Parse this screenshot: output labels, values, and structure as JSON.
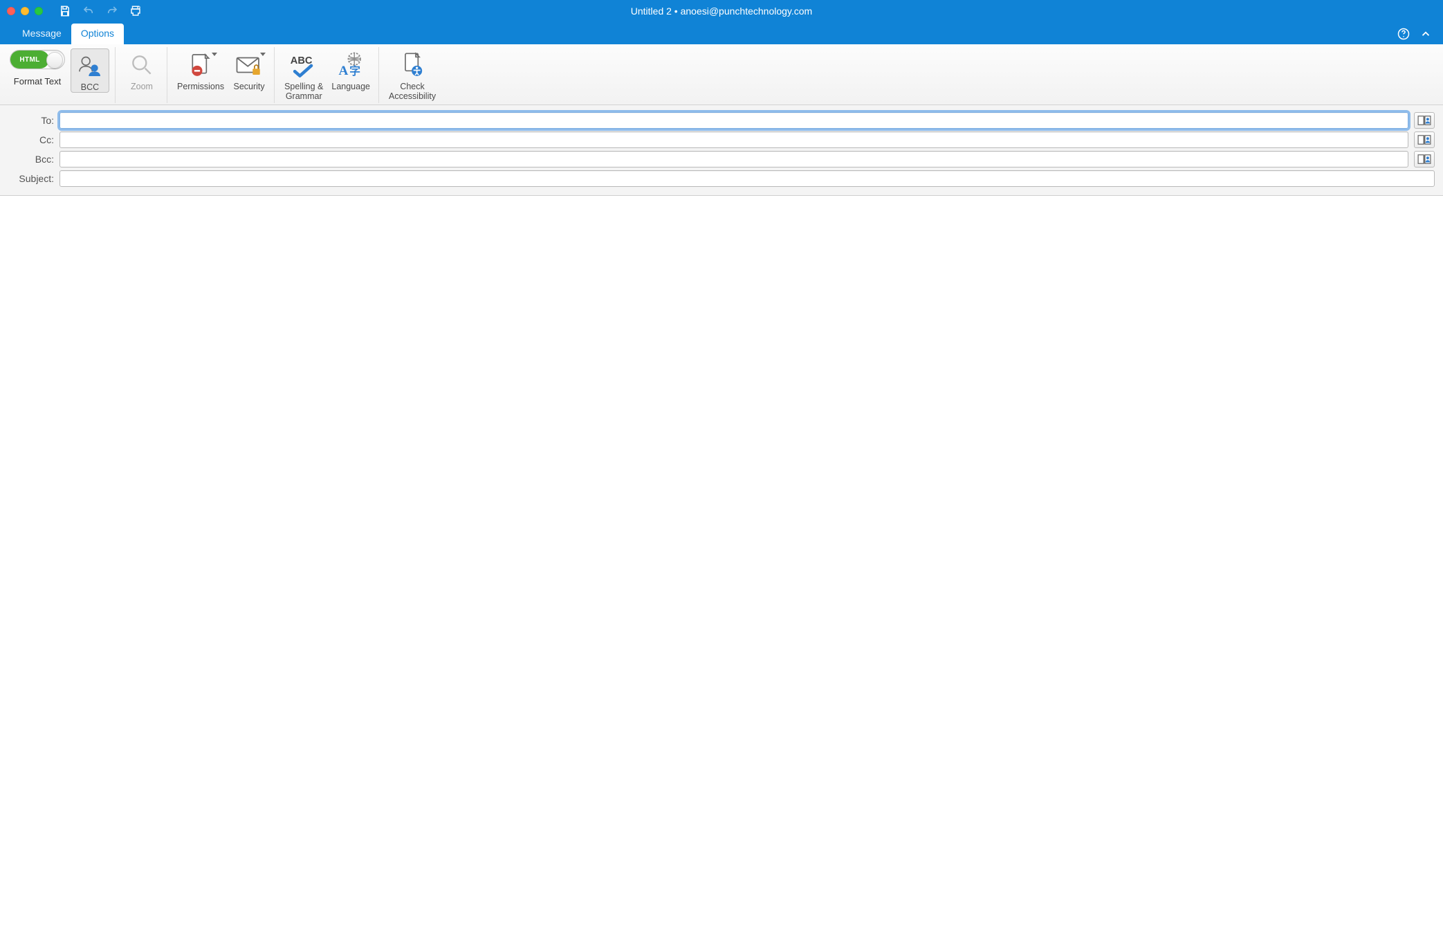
{
  "window": {
    "title": "Untitled 2 • anoesi@punchtechnology.com"
  },
  "quick_access": {
    "save": "Save",
    "undo": "Undo",
    "redo": "Redo",
    "print": "Print"
  },
  "tabs": {
    "message": "Message",
    "options": "Options"
  },
  "ribbon": {
    "format_text_label": "Format Text",
    "toggle_html": "HTML",
    "bcc": "BCC",
    "zoom": "Zoom",
    "permissions": "Permissions",
    "security": "Security",
    "spelling_grammar": "Spelling &\nGrammar",
    "language": "Language",
    "check_accessibility": "Check\nAccessibility"
  },
  "fields": {
    "to_label": "To:",
    "cc_label": "Cc:",
    "bcc_label": "Bcc:",
    "subject_label": "Subject:",
    "to_value": "",
    "cc_value": "",
    "bcc_value": "",
    "subject_value": ""
  }
}
